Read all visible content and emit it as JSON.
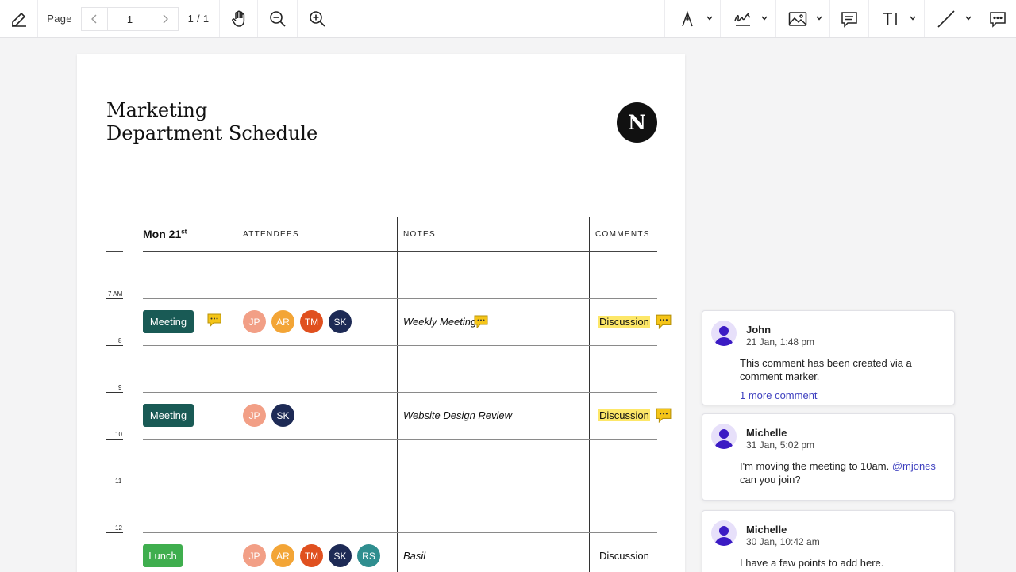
{
  "toolbar": {
    "page_label": "Page",
    "page_input": "1",
    "page_count": "1 / 1",
    "tools": [
      "pen-icon",
      "hand-icon",
      "zoom-out-icon",
      "zoom-in-icon",
      "ink-icon",
      "signature-icon",
      "image-icon",
      "note-icon",
      "text-icon",
      "line-icon",
      "comments-icon"
    ]
  },
  "document": {
    "title_line1": "Marketing",
    "title_line2": "Department Schedule",
    "logo_letter": "N",
    "day_label": "Mon 21",
    "day_suffix": "st",
    "columns": [
      "ATTENDEES",
      "NOTES",
      "COMMENTS"
    ],
    "hours": [
      "7 AM",
      "8",
      "9",
      "10",
      "11",
      "12"
    ],
    "rows": [
      {
        "tag": "Meeting",
        "attendees": [
          {
            "initials": "JP",
            "color": "#f29f86"
          },
          {
            "initials": "AR",
            "color": "#f3a536"
          },
          {
            "initials": "TM",
            "color": "#e0501f"
          },
          {
            "initials": "SK",
            "color": "#1d2a55"
          }
        ],
        "note": "Weekly Meeting",
        "comment": "Discussion"
      },
      {
        "tag": "Meeting",
        "attendees": [
          {
            "initials": "JP",
            "color": "#f29f86"
          },
          {
            "initials": "SK",
            "color": "#1d2a55"
          }
        ],
        "note": "Website Design Review",
        "comment": "Discussion"
      },
      {
        "tag": "Lunch",
        "attendees": [
          {
            "initials": "JP",
            "color": "#f29f86"
          },
          {
            "initials": "AR",
            "color": "#f3a536"
          },
          {
            "initials": "TM",
            "color": "#e0501f"
          },
          {
            "initials": "SK",
            "color": "#1d2a55"
          },
          {
            "initials": "RS",
            "color": "#2f8e8f"
          }
        ],
        "note": "Basil",
        "comment": "Discussion"
      }
    ]
  },
  "comments": [
    {
      "author": "John",
      "time": "21 Jan, 1:48 pm",
      "text": "This comment has been created via a comment marker.",
      "more": "1 more comment"
    },
    {
      "author": "Michelle",
      "time": "31 Jan, 5:02 pm",
      "text": "I'm moving the meeting to 10am.",
      "mention": "@mjones",
      "text2": "can you join?"
    },
    {
      "author": "Michelle",
      "time": "30 Jan, 10:42 am",
      "text": "I have a few points to add here."
    }
  ],
  "colors": {
    "meeting": "#195a55",
    "lunch": "#3fae4e",
    "highlight": "#fde768",
    "comment_marker": "#f5c518",
    "avatar": "#3b1bc4"
  }
}
